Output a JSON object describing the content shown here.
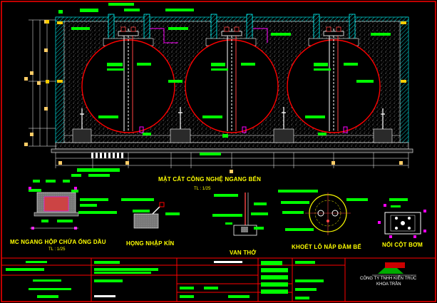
{
  "drawing": {
    "main_title": "MẶT CẮT CÔNG NGHỆ NGANG BỂN",
    "main_scale": "TL : 1/25",
    "details": [
      {
        "title": "MC NGANG HỘP CHỨA ỐNG DẦU",
        "scale": "TL : 1/25"
      },
      {
        "title": "HỌNG NHẬP KÍN",
        "scale": ""
      },
      {
        "title": "VAN THỞ",
        "scale": ""
      },
      {
        "title": "KHOÉT LỖ NẮP ĐẦM BỂ",
        "scale": ""
      },
      {
        "title": "NỐI CỘT BƠM",
        "scale": ""
      }
    ],
    "tank_count": 3
  },
  "title_block": {
    "company_line1": "CÔNG TY TNHH KIẾN TRÚC",
    "company_line2": "KHOA TRẦN"
  },
  "colors": {
    "background": "#000000",
    "frame": "#ff0000",
    "tank": "#ff0000",
    "concrete_wall": "#00ffff",
    "dimensions": "#00ff00",
    "text": "#ffff00",
    "structure": "#ffffff",
    "pipes": "#ff00ff"
  }
}
